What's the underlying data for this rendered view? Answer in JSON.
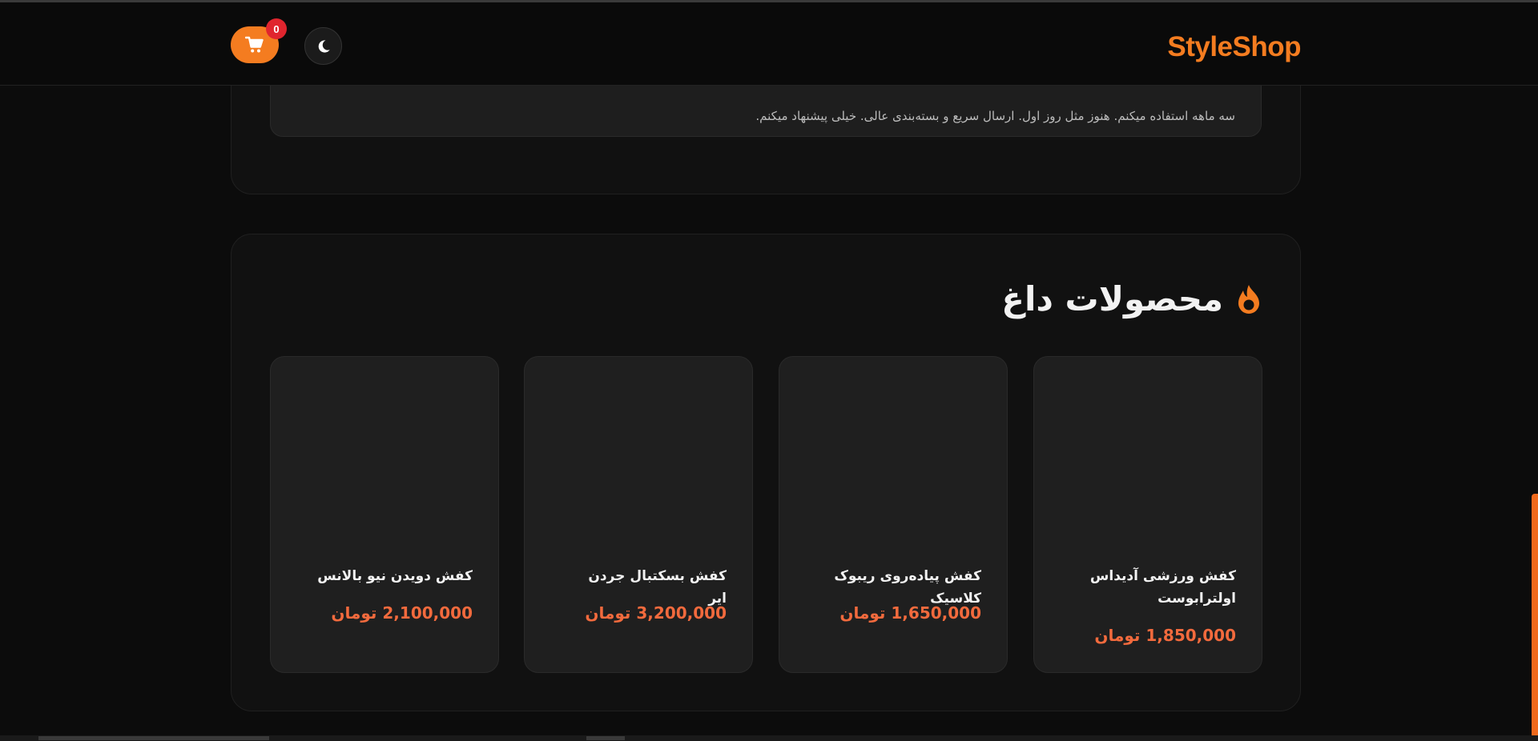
{
  "header": {
    "logo": "StyleShop",
    "cart_count": "0",
    "icons": {
      "cart": "cart-icon",
      "theme": "moon-icon"
    }
  },
  "review": {
    "text": "سه ماهه استفاده میکنم. هنوز مثل روز اول. ارسال سریع و بسته‌بندی عالی. خیلی پیشنهاد میکنم."
  },
  "hot_products": {
    "title": "محصولات داغ",
    "icon": "fire-icon",
    "items": [
      {
        "name": "کفش ورزشی آدیداس اولترابوست",
        "price": "1,850,000 تومان"
      },
      {
        "name": "کفش پیاده‌روی ریبوک کلاسیک",
        "price": "1,650,000 تومان"
      },
      {
        "name": "کفش بسکتبال جردن ایر",
        "price": "3,200,000 تومان"
      },
      {
        "name": "کفش دویدن نیو بالانس",
        "price": "2,100,000 تومان"
      }
    ]
  },
  "colors": {
    "accent": "#f47c20",
    "price": "#f26a3d",
    "badge": "#e0252e"
  }
}
